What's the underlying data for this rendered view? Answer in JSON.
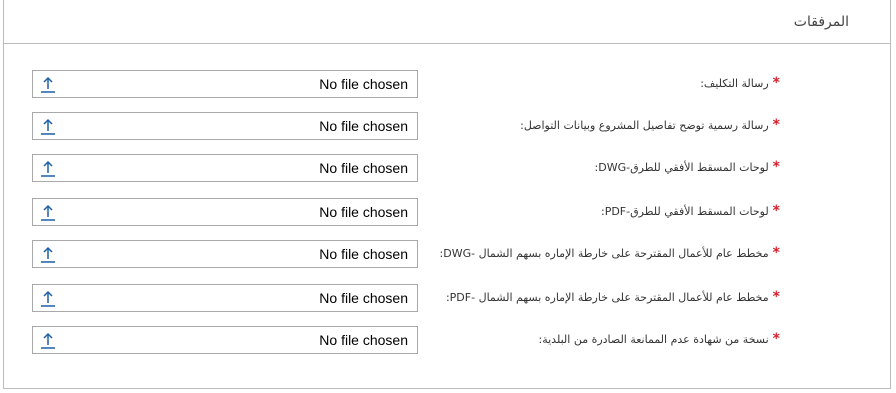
{
  "section": {
    "title": "المرفقات"
  },
  "required_marker": "*",
  "colors": {
    "required": "#d9202e",
    "upload_icon": "#1a5fa8",
    "border": "#a9a9a9"
  },
  "icons": {
    "upload": "upload-icon"
  },
  "attachments": [
    {
      "label": "رسالة التكليف:",
      "status": "No file chosen"
    },
    {
      "label": "رسالة رسمية توضح تفاصيل المشروع وبيانات التواصل:",
      "status": "No file chosen"
    },
    {
      "label": "لوحات المسقط الأفقي للطرق-DWG:",
      "status": "No file chosen"
    },
    {
      "label": "لوحات المسقط الأفقي للطرق-PDF:",
      "status": "No file chosen"
    },
    {
      "label": "مخطط عام للأعمال المقترحة على خارطة الإماره بسهم الشمال -DWG:",
      "status": "No file chosen"
    },
    {
      "label": "مخطط عام للأعمال المقترحة على خارطة الإماره بسهم الشمال -PDF:",
      "status": "No file chosen"
    },
    {
      "label": "نسخة من شهادة عدم الممانعة الصادرة من البلدية:",
      "status": "No file chosen"
    }
  ]
}
